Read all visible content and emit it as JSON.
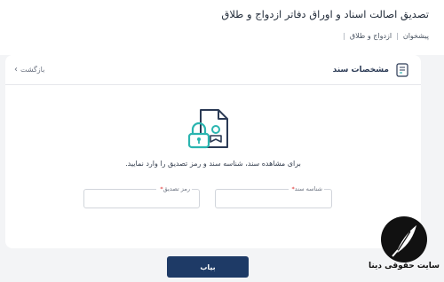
{
  "header": {
    "title": "تصدیق اصالت اسناد و اوراق دفاتر ازدواج و طلاق",
    "breadcrumb": [
      "پیشخوان",
      "ازدواج و طلاق"
    ]
  },
  "card": {
    "title": "مشخصات سند",
    "back_label": "بازگشت",
    "instruction": "برای مشاهده سند، شناسه سند و رمز تصدیق را وارد نمایید.",
    "fields": [
      {
        "label": "شناسه سند",
        "value": "",
        "required": "*"
      },
      {
        "label": "رمز تصدیق",
        "value": "",
        "required": "*"
      }
    ]
  },
  "actions": {
    "find_label": "بیاب"
  },
  "watermark": {
    "text": "سایت حقوقی دینا"
  },
  "colors": {
    "primary": "#1e3a66",
    "accent_teal": "#2bb5b0",
    "icon_navy": "#2b3a55",
    "required": "#dc2626"
  }
}
